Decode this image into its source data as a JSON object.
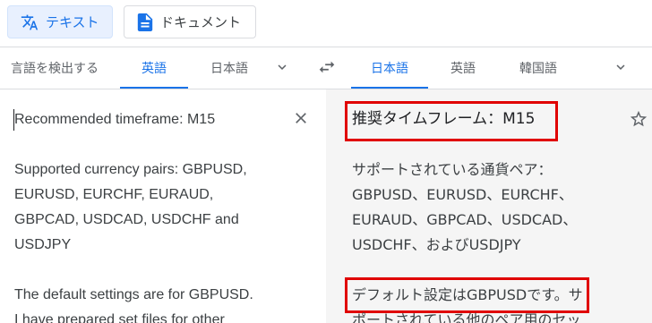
{
  "modes": {
    "text_label": "テキスト",
    "doc_label": "ドキュメント"
  },
  "source_langs": {
    "detect": "言語を検出する",
    "english": "英語",
    "japanese": "日本語"
  },
  "target_langs": {
    "japanese": "日本語",
    "english": "英語",
    "korean": "韓国語"
  },
  "source": {
    "line1": "Recommended timeframe: M15",
    "para2_l1": "Supported currency pairs: GBPUSD,",
    "para2_l2": "EURUSD, EURCHF, EURAUD,",
    "para2_l3": "GBPCAD, USDCAD, USDCHF and",
    "para2_l4": "USDJPY",
    "para3_l1": "The default settings are for GBPUSD.",
    "para3_l2": "I have prepared set files for other"
  },
  "target": {
    "line1": "推奨タイムフレーム：M15",
    "para2_l1": "サポートされている通貨ペア：",
    "para2_l2": "GBPUSD、EURUSD、EURCHF、",
    "para2_l3": "EURAUD、GBPCAD、USDCAD、",
    "para2_l4": "USDCHF、およびUSDJPY",
    "para3_l1_highlight": "デフォルト設定はGBPUSDです。",
    "para3_l1_rest": "サ",
    "para3_l2": "ポートされている他のペア用のセッ"
  },
  "colors": {
    "accent": "#1a73e8",
    "highlight": "#e00000"
  }
}
